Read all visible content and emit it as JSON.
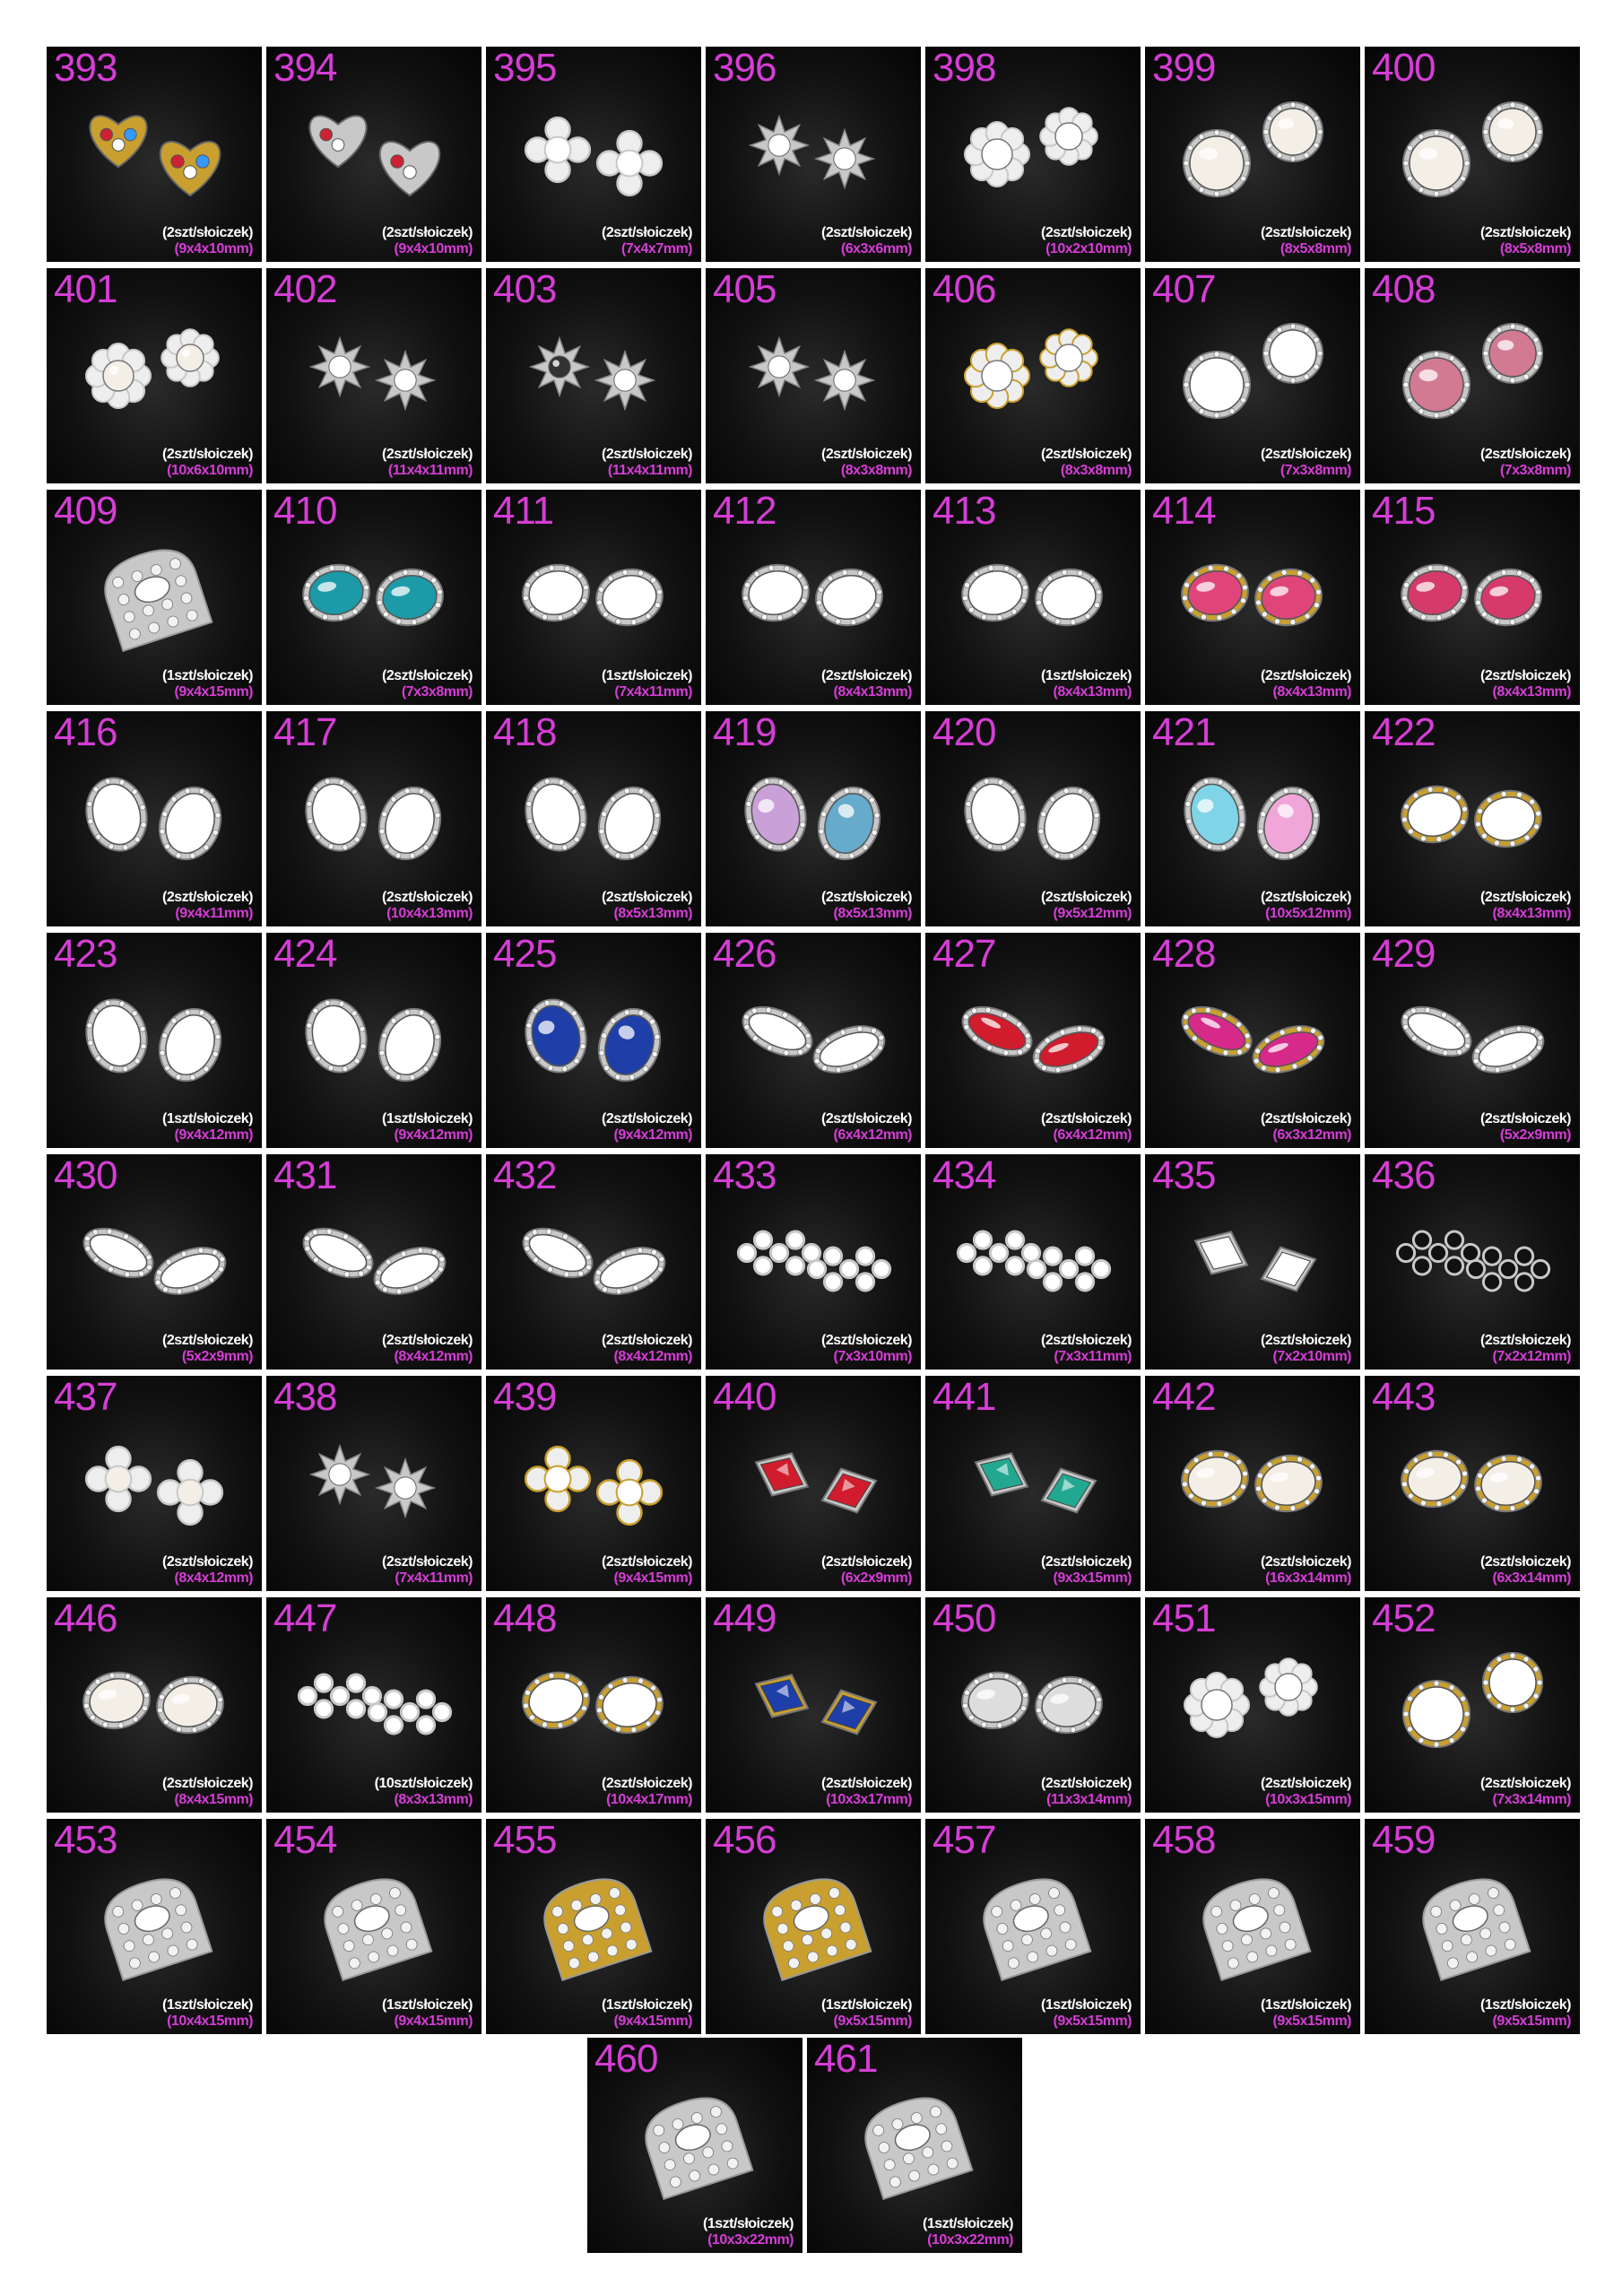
{
  "products": [
    {
      "number": "393",
      "quantity": "(2szt/słoiczek)",
      "size": "(9x4x10mm)",
      "shape": "heart",
      "metal": "gold",
      "stones": [
        "#cc2233",
        "#ffffff",
        "#3399ff"
      ]
    },
    {
      "number": "394",
      "quantity": "(2szt/słoiczek)",
      "size": "(9x4x10mm)",
      "shape": "heart",
      "metal": "silver",
      "stones": [
        "#cc2233",
        "#ffffff"
      ]
    },
    {
      "number": "395",
      "quantity": "(2szt/słoiczek)",
      "size": "(7x4x7mm)",
      "shape": "cross",
      "metal": "silver",
      "stones": [
        "#ffffff"
      ]
    },
    {
      "number": "396",
      "quantity": "(2szt/słoiczek)",
      "size": "(6x3x6mm)",
      "shape": "star",
      "metal": "silver",
      "stones": [
        "#ffffff"
      ]
    },
    {
      "number": "398",
      "quantity": "(2szt/słoiczek)",
      "size": "(10x2x10mm)",
      "shape": "flower",
      "metal": "silver",
      "stones": [
        "#ffffff"
      ]
    },
    {
      "number": "399",
      "quantity": "(2szt/słoiczek)",
      "size": "(8x5x8mm)",
      "shape": "round",
      "metal": "silver",
      "stones": [
        "#f3efe6"
      ]
    },
    {
      "number": "400",
      "quantity": "(2szt/słoiczek)",
      "size": "(8x5x8mm)",
      "shape": "round",
      "metal": "silver",
      "stones": [
        "#f3efe6"
      ]
    },
    {
      "number": "401",
      "quantity": "(2szt/słoiczek)",
      "size": "(10x6x10mm)",
      "shape": "flower",
      "metal": "silver",
      "stones": [
        "#f3efe6"
      ]
    },
    {
      "number": "402",
      "quantity": "(2szt/słoiczek)",
      "size": "(11x4x11mm)",
      "shape": "star",
      "metal": "silver",
      "stones": [
        "#ffffff"
      ]
    },
    {
      "number": "403",
      "quantity": "(2szt/słoiczek)",
      "size": "(11x4x11mm)",
      "shape": "star",
      "metal": "silver",
      "stones": [
        "#333333",
        "#ffffff"
      ]
    },
    {
      "number": "405",
      "quantity": "(2szt/słoiczek)",
      "size": "(8x3x8mm)",
      "shape": "star",
      "metal": "silver",
      "stones": [
        "#ffffff"
      ]
    },
    {
      "number": "406",
      "quantity": "(2szt/słoiczek)",
      "size": "(8x3x8mm)",
      "shape": "flower",
      "metal": "gold",
      "stones": [
        "#ffffff"
      ]
    },
    {
      "number": "407",
      "quantity": "(2szt/słoiczek)",
      "size": "(7x3x8mm)",
      "shape": "round",
      "metal": "silver",
      "stones": [
        "#ffffff"
      ]
    },
    {
      "number": "408",
      "quantity": "(2szt/słoiczek)",
      "size": "(7x3x8mm)",
      "shape": "round",
      "metal": "silver",
      "stones": [
        "#d27a92"
      ]
    },
    {
      "number": "409",
      "quantity": "(1szt/słoiczek)",
      "size": "(9x4x15mm)",
      "shape": "nail",
      "metal": "silver",
      "stones": [
        "#ffffff"
      ]
    },
    {
      "number": "410",
      "quantity": "(2szt/słoiczek)",
      "size": "(7x3x8mm)",
      "shape": "oval",
      "metal": "silver",
      "stones": [
        "#1c9aa8"
      ]
    },
    {
      "number": "411",
      "quantity": "(1szt/słoiczek)",
      "size": "(7x4x11mm)",
      "shape": "oval",
      "metal": "silver",
      "stones": [
        "#ffffff"
      ]
    },
    {
      "number": "412",
      "quantity": "(2szt/słoiczek)",
      "size": "(8x4x13mm)",
      "shape": "oval",
      "metal": "silver",
      "stones": [
        "#ffffff"
      ]
    },
    {
      "number": "413",
      "quantity": "(1szt/słoiczek)",
      "size": "(8x4x13mm)",
      "shape": "oval",
      "metal": "silver",
      "stones": [
        "#ffffff"
      ]
    },
    {
      "number": "414",
      "quantity": "(2szt/słoiczek)",
      "size": "(8x4x13mm)",
      "shape": "oval",
      "metal": "gold",
      "stones": [
        "#e0457a"
      ]
    },
    {
      "number": "415",
      "quantity": "(2szt/słoiczek)",
      "size": "(8x4x13mm)",
      "shape": "oval",
      "metal": "silver",
      "stones": [
        "#d63a6a"
      ]
    },
    {
      "number": "416",
      "quantity": "(2szt/słoiczek)",
      "size": "(9x4x11mm)",
      "shape": "drop",
      "metal": "silver",
      "stones": [
        "#ffffff"
      ]
    },
    {
      "number": "417",
      "quantity": "(2szt/słoiczek)",
      "size": "(10x4x13mm)",
      "shape": "drop",
      "metal": "silver",
      "stones": [
        "#ffffff"
      ]
    },
    {
      "number": "418",
      "quantity": "(2szt/słoiczek)",
      "size": "(8x5x13mm)",
      "shape": "drop",
      "metal": "silver",
      "stones": [
        "#ffffff"
      ]
    },
    {
      "number": "419",
      "quantity": "(2szt/słoiczek)",
      "size": "(8x5x13mm)",
      "shape": "drop",
      "metal": "silver",
      "stones": [
        "#c9a0d8",
        "#66aacc"
      ]
    },
    {
      "number": "420",
      "quantity": "(2szt/słoiczek)",
      "size": "(9x5x12mm)",
      "shape": "drop",
      "metal": "silver",
      "stones": [
        "#ffffff"
      ]
    },
    {
      "number": "421",
      "quantity": "(2szt/słoiczek)",
      "size": "(10x5x12mm)",
      "shape": "drop",
      "metal": "silver",
      "stones": [
        "#7fd4e8",
        "#f0a6d8"
      ]
    },
    {
      "number": "422",
      "quantity": "(2szt/słoiczek)",
      "size": "(8x4x13mm)",
      "shape": "oval",
      "metal": "gold",
      "stones": [
        "#ffffff"
      ]
    },
    {
      "number": "423",
      "quantity": "(1szt/słoiczek)",
      "size": "(9x4x12mm)",
      "shape": "drop",
      "metal": "silver",
      "stones": [
        "#ffffff"
      ]
    },
    {
      "number": "424",
      "quantity": "(1szt/słoiczek)",
      "size": "(9x4x12mm)",
      "shape": "drop",
      "metal": "silver",
      "stones": [
        "#ffffff"
      ]
    },
    {
      "number": "425",
      "quantity": "(2szt/słoiczek)",
      "size": "(9x4x12mm)",
      "shape": "drop",
      "metal": "silver",
      "stones": [
        "#1f3fa8"
      ]
    },
    {
      "number": "426",
      "quantity": "(2szt/słoiczek)",
      "size": "(6x4x12mm)",
      "shape": "marquise",
      "metal": "silver",
      "stones": [
        "#ffffff"
      ]
    },
    {
      "number": "427",
      "quantity": "(2szt/słoiczek)",
      "size": "(6x4x12mm)",
      "shape": "marquise",
      "metal": "silver",
      "stones": [
        "#d01c2c"
      ]
    },
    {
      "number": "428",
      "quantity": "(2szt/słoiczek)",
      "size": "(6x3x12mm)",
      "shape": "marquise",
      "metal": "gold",
      "stones": [
        "#d62a8a"
      ]
    },
    {
      "number": "429",
      "quantity": "(2szt/słoiczek)",
      "size": "(5x2x9mm)",
      "shape": "marquise",
      "metal": "silver",
      "stones": [
        "#ffffff"
      ]
    },
    {
      "number": "430",
      "quantity": "(2szt/słoiczek)",
      "size": "(5x2x9mm)",
      "shape": "marquise",
      "metal": "silver",
      "stones": [
        "#ffffff"
      ]
    },
    {
      "number": "431",
      "quantity": "(2szt/słoiczek)",
      "size": "(8x4x12mm)",
      "shape": "marquise",
      "metal": "silver",
      "stones": [
        "#ffffff"
      ]
    },
    {
      "number": "432",
      "quantity": "(2szt/słoiczek)",
      "size": "(8x4x12mm)",
      "shape": "marquise",
      "metal": "silver",
      "stones": [
        "#ffffff"
      ]
    },
    {
      "number": "433",
      "quantity": "(2szt/słoiczek)",
      "size": "(7x3x10mm)",
      "shape": "cluster",
      "metal": "silver",
      "stones": [
        "#ffffff"
      ]
    },
    {
      "number": "434",
      "quantity": "(2szt/słoiczek)",
      "size": "(7x3x11mm)",
      "shape": "cluster",
      "metal": "silver",
      "stones": [
        "#ffffff"
      ]
    },
    {
      "number": "435",
      "quantity": "(2szt/słoiczek)",
      "size": "(7x2x10mm)",
      "shape": "rhombus",
      "metal": "silver",
      "stones": [
        "#ffffff"
      ]
    },
    {
      "number": "436",
      "quantity": "(2szt/słoiczek)",
      "size": "(7x2x12mm)",
      "shape": "cluster",
      "metal": "silver",
      "stones": [
        "#111111"
      ]
    },
    {
      "number": "437",
      "quantity": "(2szt/słoiczek)",
      "size": "(8x4x12mm)",
      "shape": "cross",
      "metal": "silver",
      "stones": [
        "#f3efe6"
      ]
    },
    {
      "number": "438",
      "quantity": "(2szt/słoiczek)",
      "size": "(7x4x11mm)",
      "shape": "star",
      "metal": "silver",
      "stones": [
        "#ffffff"
      ]
    },
    {
      "number": "439",
      "quantity": "(2szt/słoiczek)",
      "size": "(9x4x15mm)",
      "shape": "cross",
      "metal": "gold",
      "stones": [
        "#ffffff"
      ]
    },
    {
      "number": "440",
      "quantity": "(2szt/słoiczek)",
      "size": "(6x2x9mm)",
      "shape": "rhombus",
      "metal": "silver",
      "stones": [
        "#d01c2c"
      ]
    },
    {
      "number": "441",
      "quantity": "(2szt/słoiczek)",
      "size": "(9x3x15mm)",
      "shape": "rhombus",
      "metal": "silver",
      "stones": [
        "#22a890"
      ]
    },
    {
      "number": "442",
      "quantity": "(2szt/słoiczek)",
      "size": "(16x3x14mm)",
      "shape": "oval",
      "metal": "gold",
      "stones": [
        "#f3efe6"
      ]
    },
    {
      "number": "443",
      "quantity": "(2szt/słoiczek)",
      "size": "(6x3x14mm)",
      "shape": "oval",
      "metal": "gold",
      "stones": [
        "#f3efe6"
      ]
    },
    {
      "number": "446",
      "quantity": "(2szt/słoiczek)",
      "size": "(8x4x15mm)",
      "shape": "oval",
      "metal": "silver",
      "stones": [
        "#f3efe6"
      ]
    },
    {
      "number": "447",
      "quantity": "(10szt/słoiczek)",
      "size": "(8x3x13mm)",
      "shape": "cluster",
      "metal": "silver",
      "stones": [
        "#ffffff"
      ]
    },
    {
      "number": "448",
      "quantity": "(2szt/słoiczek)",
      "size": "(10x4x17mm)",
      "shape": "oval",
      "metal": "gold",
      "stones": [
        "#ffffff"
      ]
    },
    {
      "number": "449",
      "quantity": "(2szt/słoiczek)",
      "size": "(10x3x17mm)",
      "shape": "rhombus",
      "metal": "gold",
      "stones": [
        "#1f3fa8"
      ]
    },
    {
      "number": "450",
      "quantity": "(2szt/słoiczek)",
      "size": "(11x3x14mm)",
      "shape": "oval",
      "metal": "silver",
      "stones": [
        "#dddddd"
      ]
    },
    {
      "number": "451",
      "quantity": "(2szt/słoiczek)",
      "size": "(10x3x15mm)",
      "shape": "flower",
      "metal": "silver",
      "stones": [
        "#ffffff"
      ]
    },
    {
      "number": "452",
      "quantity": "(2szt/słoiczek)",
      "size": "(7x3x14mm)",
      "shape": "round",
      "metal": "gold",
      "stones": [
        "#ffffff"
      ]
    },
    {
      "number": "453",
      "quantity": "(1szt/słoiczek)",
      "size": "(10x4x15mm)",
      "shape": "nail",
      "metal": "silver",
      "stones": [
        "#ffffff"
      ]
    },
    {
      "number": "454",
      "quantity": "(1szt/słoiczek)",
      "size": "(9x4x15mm)",
      "shape": "nail",
      "metal": "silver",
      "stones": [
        "#ffffff"
      ]
    },
    {
      "number": "455",
      "quantity": "(1szt/słoiczek)",
      "size": "(9x4x15mm)",
      "shape": "nail",
      "metal": "gold",
      "stones": [
        "#ffffff"
      ]
    },
    {
      "number": "456",
      "quantity": "(1szt/słoiczek)",
      "size": "(9x5x15mm)",
      "shape": "nail",
      "metal": "gold",
      "stones": [
        "#ffffff"
      ]
    },
    {
      "number": "457",
      "quantity": "(1szt/słoiczek)",
      "size": "(9x5x15mm)",
      "shape": "nail",
      "metal": "silver",
      "stones": [
        "#ffffff"
      ]
    },
    {
      "number": "458",
      "quantity": "(1szt/słoiczek)",
      "size": "(9x5x15mm)",
      "shape": "nail",
      "metal": "silver",
      "stones": [
        "#ffffff"
      ]
    },
    {
      "number": "459",
      "quantity": "(1szt/słoiczek)",
      "size": "(9x5x15mm)",
      "shape": "nail",
      "metal": "silver",
      "stones": [
        "#ffffff"
      ]
    },
    {
      "number": "460",
      "quantity": "(1szt/słoiczek)",
      "size": "(10x3x22mm)",
      "shape": "nail",
      "metal": "silver",
      "stones": [
        "#ffffff"
      ]
    },
    {
      "number": "461",
      "quantity": "(1szt/słoiczek)",
      "size": "(10x3x22mm)",
      "shape": "nail",
      "metal": "silver",
      "stones": [
        "#ffffff"
      ]
    }
  ],
  "colors": {
    "number_text": "#d63dd6",
    "size_text": "#d63dd6",
    "quantity_text": "#ffffff",
    "tile_background": "#0b0b0b",
    "page_background": "#ffffff",
    "gold_metal": "#c9a030",
    "silver_metal": "#c8c8c8"
  }
}
